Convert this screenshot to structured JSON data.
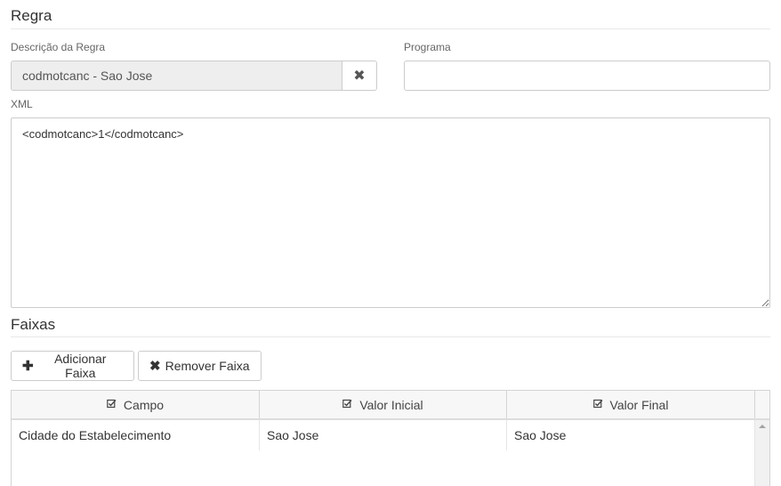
{
  "regra": {
    "title": "Regra",
    "descricao_label": "Descrição da Regra",
    "descricao_value": "codmotcanc - Sao Jose",
    "clear_icon": "✖",
    "programa_label": "Programa",
    "programa_value": "",
    "xml_label": "XML",
    "xml_value": "<codmotcanc>1</codmotcanc>"
  },
  "faixas": {
    "title": "Faixas",
    "add_label": "Adicionar Faixa",
    "add_icon": "✚",
    "remove_label": "Remover Faixa",
    "remove_icon": "✖",
    "columns": [
      "Campo",
      "Valor Inicial",
      "Valor Final"
    ],
    "column_icon": "check-square-icon",
    "rows": [
      [
        "Cidade do Estabelecimento",
        "Sao Jose",
        "Sao Jose"
      ]
    ]
  }
}
